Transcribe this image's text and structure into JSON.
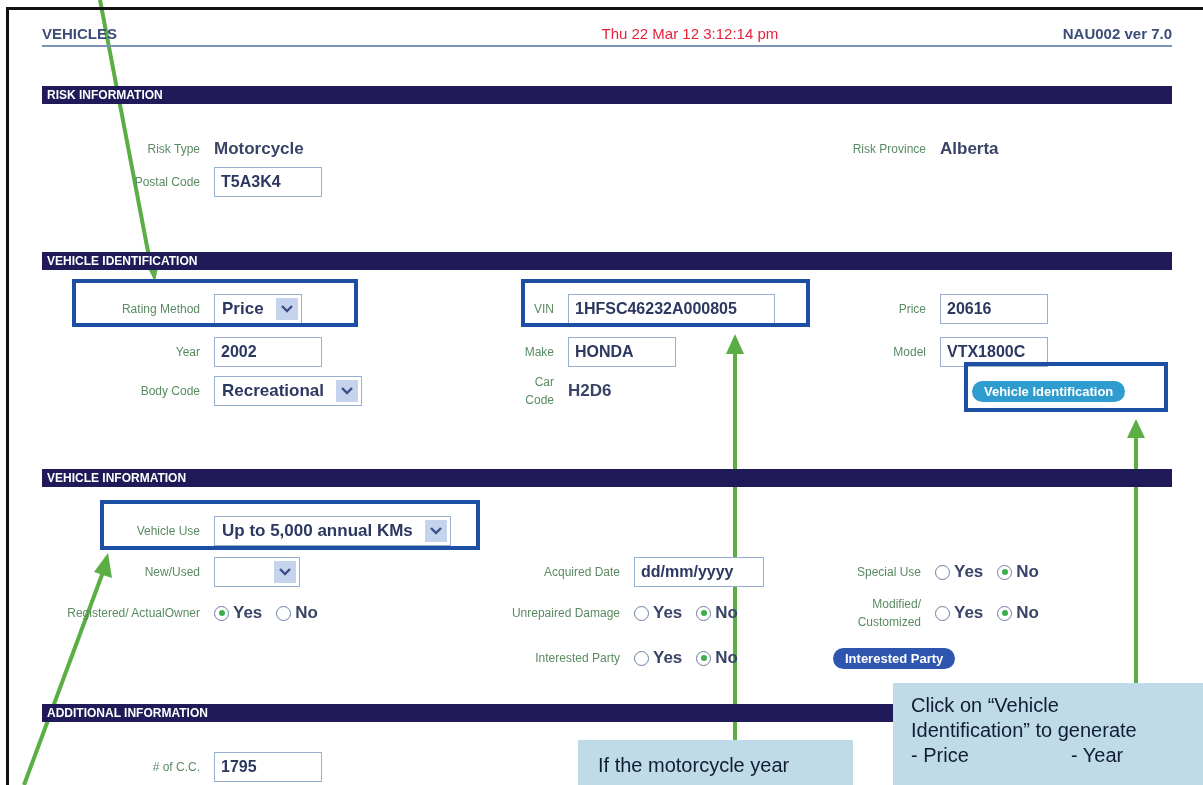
{
  "header": {
    "title": "VEHICLES",
    "datetime": "Thu 22 Mar 12  3:12:14 pm",
    "version": "NAU002 ver 7.0"
  },
  "sections": [
    {
      "title": "RISK INFORMATION",
      "rows": [
        {
          "left": {
            "label": "Risk Type",
            "kind": "value",
            "value": "Motorcycle"
          },
          "right": {
            "label": "Risk Province",
            "kind": "value",
            "value": "Alberta"
          }
        },
        {
          "left": {
            "label": "Postal Code",
            "kind": "text",
            "value": "T5A3K4"
          }
        }
      ]
    },
    {
      "title": "VEHICLE IDENTIFICATION",
      "rows": [
        {
          "left": {
            "label": "Rating Method",
            "kind": "select",
            "value": "Price"
          },
          "middle": {
            "label": "VIN",
            "kind": "text",
            "value": "1HFSC46232A000805"
          },
          "right": {
            "label": "Price",
            "kind": "text",
            "value": "20616"
          }
        },
        {
          "left": {
            "label": "Year",
            "kind": "text",
            "value": "2002"
          },
          "middle": {
            "label": "Make",
            "kind": "text",
            "value": "HONDA"
          },
          "right": {
            "label": "Model",
            "kind": "text",
            "value": "VTX1800C"
          }
        },
        {
          "left": {
            "label": "Body Code",
            "kind": "select",
            "value": "Recreational"
          },
          "middle": {
            "label": "Car Code",
            "kind": "value",
            "value": "H2D6"
          },
          "right": {
            "kind": "button",
            "value": "Vehicle Identification"
          }
        }
      ]
    },
    {
      "title": "VEHICLE INFORMATION",
      "rows": [
        {
          "left": {
            "label": "Vehicle Use",
            "kind": "select",
            "value": "Up to 5,000 annual KMs"
          }
        },
        {
          "left": {
            "label": "New/Used",
            "kind": "select"
          },
          "middle": {
            "label": "Acquired Date",
            "kind": "text",
            "value": "dd/mm/yyyy"
          },
          "right": {
            "label": "Special Use",
            "kind": "radio",
            "options": [
              {
                "label": "Yes",
                "selected": false
              },
              {
                "label": "No",
                "selected": true
              }
            ]
          }
        },
        {
          "left": {
            "label": "Registered/ ActualOwner",
            "kind": "radio",
            "options": [
              {
                "label": "Yes",
                "selected": true
              },
              {
                "label": "No",
                "selected": false
              }
            ]
          },
          "middle": {
            "label": "Unrepaired Damage",
            "kind": "radio",
            "options": [
              {
                "label": "Yes",
                "selected": false
              },
              {
                "label": "No",
                "selected": true
              }
            ]
          },
          "right": {
            "label": "Modified/ Customized",
            "kind": "radio",
            "options": [
              {
                "label": "Yes",
                "selected": false
              },
              {
                "label": "No",
                "selected": true
              }
            ]
          }
        },
        {
          "middle": {
            "label": "Interested Party",
            "kind": "radio",
            "options": [
              {
                "label": "Yes",
                "selected": false
              },
              {
                "label": "No",
                "selected": true
              }
            ]
          },
          "right": {
            "kind": "button",
            "value": "Interested Party"
          }
        }
      ]
    },
    {
      "title": "ADDITIONAL INFORMATION",
      "rows": [
        {
          "left": {
            "label": "# of C.C.",
            "kind": "text",
            "value": "1795"
          }
        }
      ]
    }
  ],
  "callouts": [
    {
      "lines": [
        "If the motorcycle year"
      ]
    },
    {
      "lines": [
        "Click on “Vehicle",
        "Identification” to generate"
      ],
      "bullets": [
        "- Price",
        "- Year"
      ]
    }
  ]
}
